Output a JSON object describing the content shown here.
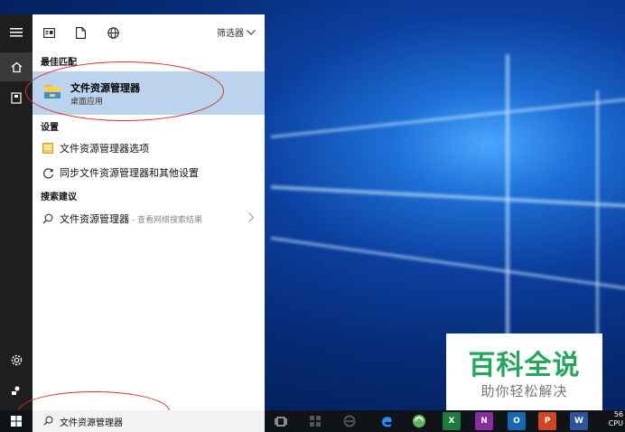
{
  "filter": {
    "label": "筛选器"
  },
  "sections": {
    "best_match": "最佳匹配",
    "settings": "设置",
    "web_suggestions": "搜索建议"
  },
  "best_match": {
    "title": "文件资源管理器",
    "subtitle": "桌面应用"
  },
  "settings_items": [
    {
      "label": "文件资源管理器选项"
    },
    {
      "label": "同步文件资源管理器和其他设置"
    }
  ],
  "web_suggestion": {
    "label": "文件资源管理器",
    "suffix": " - 查看网络搜索结果"
  },
  "search": {
    "query": "文件资源管理器"
  },
  "taskbar": {
    "excel_letter": "X",
    "onenote_letter": "N",
    "outlook_letter": "O",
    "powerpoint_letter": "P",
    "word_letter": "W",
    "clock_top": "56",
    "clock_bottom": "CPU"
  },
  "watermark": {
    "main": "百科全说",
    "sub": "助你轻松解决"
  },
  "colors": {
    "accent_highlight": "#bcd3ed",
    "annotation": "#d9302c",
    "watermark_green": "#22a85a"
  }
}
